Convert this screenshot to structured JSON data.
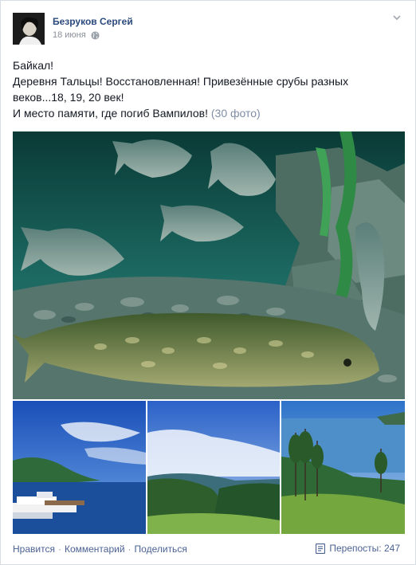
{
  "post": {
    "author": "Безруков Сергей",
    "date": "18 июня",
    "privacy_icon": "globe-icon",
    "text_lines": [
      "Байкал!",
      "Деревня Тальцы! Восстановленная! Привезённые срубы разных",
      "веков...18, 19, 20 век!",
      "И место памяти, где погиб Вампилов!"
    ],
    "photos_link": "(30 фото)"
  },
  "actions": {
    "like": "Нравится",
    "comment": "Комментарий",
    "share": "Поделиться",
    "separator": "·",
    "shares_label": "Перепосты: 247",
    "shares_icon": "doc-icon"
  },
  "colors": {
    "link": "#4b6293",
    "author": "#2b4a7d",
    "muted": "#8a909a"
  }
}
